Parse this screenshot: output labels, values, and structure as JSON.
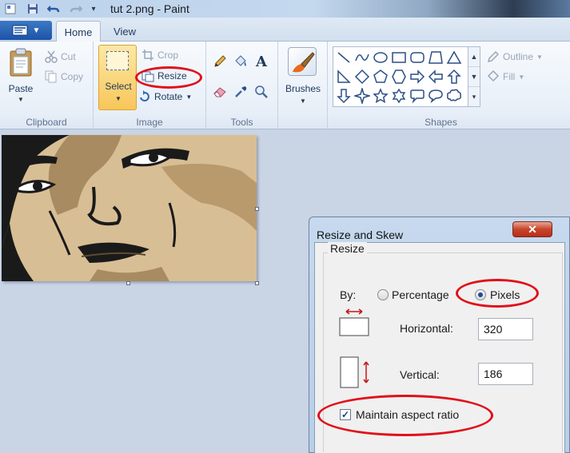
{
  "window": {
    "title": "tut 2.png - Paint"
  },
  "tabs": [
    {
      "label": "Home"
    },
    {
      "label": "View"
    }
  ],
  "ribbon": {
    "clipboard": {
      "group_label": "Clipboard",
      "paste": "Paste",
      "cut": "Cut",
      "copy": "Copy"
    },
    "image": {
      "group_label": "Image",
      "select": "Select",
      "crop": "Crop",
      "resize": "Resize",
      "rotate": "Rotate"
    },
    "tools": {
      "group_label": "Tools"
    },
    "brushes": {
      "label": "Brushes"
    },
    "shapes": {
      "group_label": "Shapes",
      "outline": "Outline",
      "fill": "Fill"
    }
  },
  "dialog": {
    "title": "Resize and Skew",
    "section": "Resize",
    "by_label": "By:",
    "percentage": "Percentage",
    "pixels": "Pixels",
    "selected_unit": "Pixels",
    "horizontal_label": "Horizontal:",
    "horizontal_value": "320",
    "vertical_label": "Vertical:",
    "vertical_value": "186",
    "maintain_aspect": "Maintain aspect ratio",
    "maintain_aspect_checked": true
  },
  "colors": {
    "annotation_red": "#e0101a",
    "ribbon_accent": "#1b53a8",
    "close_red": "#c7452b"
  }
}
